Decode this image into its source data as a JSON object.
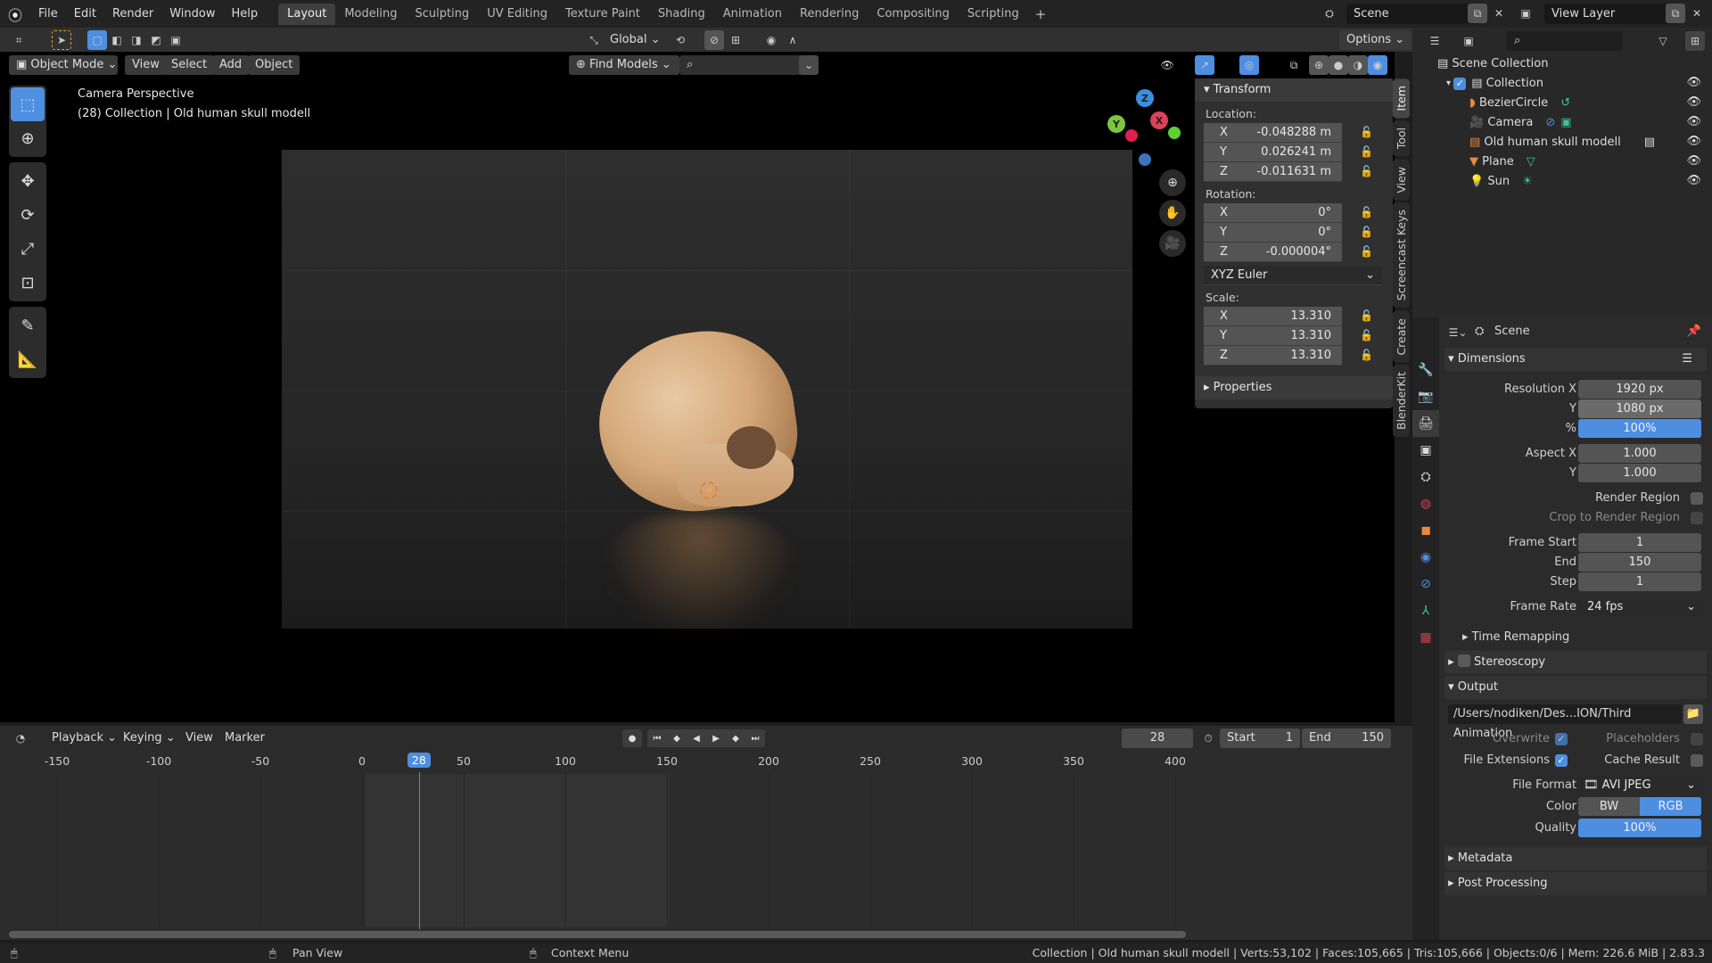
{
  "app": {
    "name": "Blender",
    "version": "2.83.3"
  },
  "topbar": {
    "menus": [
      "File",
      "Edit",
      "Render",
      "Window",
      "Help"
    ],
    "workspaces": [
      "Layout",
      "Modeling",
      "Sculpting",
      "UV Editing",
      "Texture Paint",
      "Shading",
      "Animation",
      "Rendering",
      "Compositing",
      "Scripting"
    ],
    "active_workspace": "Layout",
    "scene": "Scene",
    "view_layer": "View Layer"
  },
  "tool_header": {
    "orientation": "Global",
    "options_label": "Options"
  },
  "viewport_header": {
    "mode": "Object Mode",
    "menus": [
      "View",
      "Select",
      "Add",
      "Object"
    ],
    "find_models": "Find Models",
    "search_placeholder": ""
  },
  "viewport": {
    "overlay_title": "Camera Perspective",
    "overlay_subtitle": "(28) Collection | Old human skull modell",
    "gizmo_axes": {
      "x": "X",
      "y": "Y",
      "z": "Z"
    }
  },
  "npanel": {
    "tabs": [
      "Item",
      "Tool",
      "View",
      "Screencast Keys",
      "Create",
      "BlenderKit"
    ],
    "active_tab": "Item",
    "transform_title": "Transform",
    "location_label": "Location:",
    "location": [
      {
        "axis": "X",
        "value": "-0.048288 m"
      },
      {
        "axis": "Y",
        "value": "0.026241 m"
      },
      {
        "axis": "Z",
        "value": "-0.011631 m"
      }
    ],
    "rotation_label": "Rotation:",
    "rotation": [
      {
        "axis": "X",
        "value": "0°"
      },
      {
        "axis": "Y",
        "value": "0°"
      },
      {
        "axis": "Z",
        "value": "-0.000004°"
      }
    ],
    "rotation_mode": "XYZ Euler",
    "scale_label": "Scale:",
    "scale": [
      {
        "axis": "X",
        "value": "13.310"
      },
      {
        "axis": "Y",
        "value": "13.310"
      },
      {
        "axis": "Z",
        "value": "13.310"
      }
    ],
    "properties_title": "Properties"
  },
  "outliner": {
    "root": "Scene Collection",
    "collection": "Collection",
    "items": [
      {
        "name": "BezierCircle",
        "icon": "curve-icon"
      },
      {
        "name": "Camera",
        "icon": "camera-icon"
      },
      {
        "name": "Old human skull modell",
        "icon": "collection-instance-icon"
      },
      {
        "name": "Plane",
        "icon": "mesh-icon"
      },
      {
        "name": "Sun",
        "icon": "light-icon"
      }
    ]
  },
  "properties": {
    "context": "Scene",
    "dimensions": {
      "title": "Dimensions",
      "resolution_x_label": "Resolution X",
      "resolution_x": "1920 px",
      "resolution_y_label": "Y",
      "resolution_y": "1080 px",
      "percent_label": "%",
      "percent": "100%",
      "aspect_x_label": "Aspect X",
      "aspect_x": "1.000",
      "aspect_y_label": "Y",
      "aspect_y": "1.000",
      "render_region": "Render Region",
      "crop_region": "Crop to Render Region",
      "frame_start_label": "Frame Start",
      "frame_start": "1",
      "end_label": "End",
      "end": "150",
      "step_label": "Step",
      "step": "1",
      "frame_rate_label": "Frame Rate",
      "frame_rate": "24 fps",
      "time_remapping": "Time Remapping"
    },
    "stereoscopy": "Stereoscopy",
    "output": {
      "title": "Output",
      "path": "/Users/nodiken/Des...ION/Third Animation",
      "overwrite": "Overwrite",
      "placeholders": "Placeholders",
      "file_extensions": "File Extensions",
      "cache_result": "Cache Result",
      "file_format_label": "File Format",
      "file_format": "AVI JPEG",
      "color_label": "Color",
      "color_options": [
        "BW",
        "RGB"
      ],
      "color_selected": "RGB",
      "quality_label": "Quality",
      "quality": "100%"
    },
    "metadata": "Metadata",
    "post_processing": "Post Processing"
  },
  "timeline": {
    "menus": [
      "Playback",
      "Keying",
      "View",
      "Marker"
    ],
    "current_frame": "28",
    "start_label": "Start",
    "start": "1",
    "end_label": "End",
    "end": "150",
    "ticks": [
      "-150",
      "-100",
      "-50",
      "0",
      "50",
      "100",
      "150",
      "200",
      "250",
      "300",
      "350",
      "400"
    ]
  },
  "statusbar": {
    "hint_pan": "Pan View",
    "hint_context": "Context Menu",
    "stats": "Collection | Old human skull modell | Verts:53,102 | Faces:105,665 | Tris:105,666 | Objects:0/6 | Mem: 226.6 MiB | 2.83.3"
  }
}
